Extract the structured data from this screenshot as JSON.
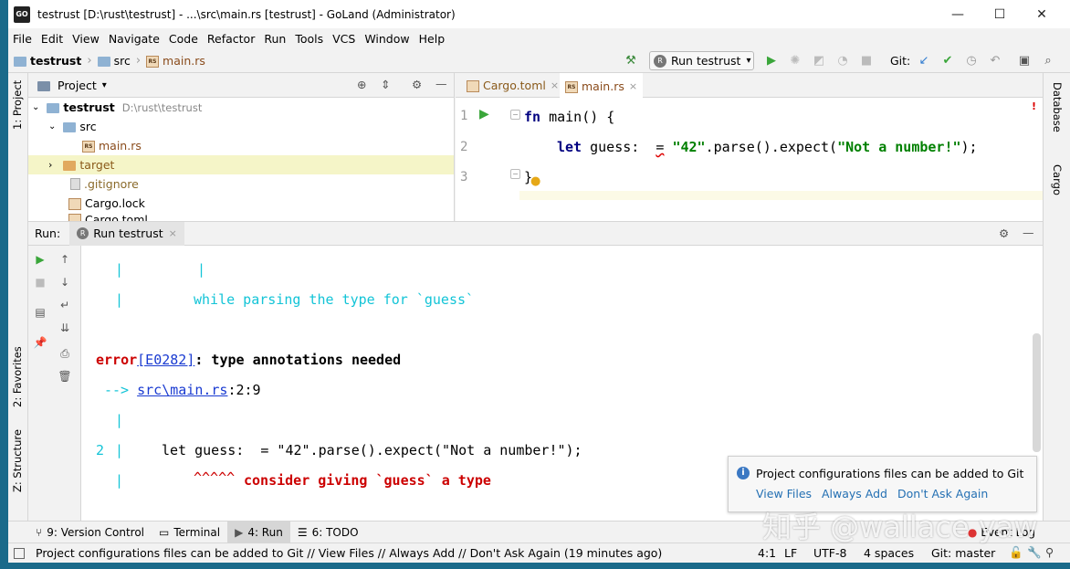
{
  "title": {
    "text": "testrust [D:\\rust\\testrust] - ...\\src\\main.rs [testrust] - GoLand (Administrator)",
    "app_icon": "GO"
  },
  "window_controls": {
    "minimize": "—",
    "maximize": "☐",
    "close": "✕"
  },
  "menu": [
    "File",
    "Edit",
    "View",
    "Navigate",
    "Code",
    "Refactor",
    "Run",
    "Tools",
    "VCS",
    "Window",
    "Help"
  ],
  "breadcrumb": {
    "project": "testrust",
    "folder": "src",
    "file": "main.rs"
  },
  "toolbar": {
    "run_config": "Run testrust",
    "git_label": "Git:"
  },
  "left_tool_windows": {
    "project": "1: Project",
    "favorites": "2: Favorites",
    "structure": "Z: Structure"
  },
  "right_tool_windows": {
    "database": "Database",
    "cargo": "Cargo"
  },
  "project_panel": {
    "header": "Project",
    "tree": [
      {
        "label": "testrust",
        "path": "D:\\rust\\testrust",
        "icon": "folder-icon"
      },
      {
        "label": "src",
        "icon": "folder-icon"
      },
      {
        "label": "main.rs",
        "icon": "rust-file-icon"
      },
      {
        "label": "target",
        "icon": "folder-icon"
      },
      {
        "label": ".gitignore",
        "icon": "file-icon"
      },
      {
        "label": "Cargo.lock",
        "icon": "file-icon"
      },
      {
        "label": "Cargo.toml",
        "icon": "file-icon"
      }
    ]
  },
  "editor": {
    "tabs": [
      {
        "label": "Cargo.toml"
      },
      {
        "label": "main.rs"
      }
    ],
    "line_numbers": [
      "1",
      "2",
      "3"
    ],
    "lines": [
      {
        "kw": "fn",
        "rest": " main() {"
      },
      {
        "kw": "let",
        "mid": " guess:  ",
        "squig": "=",
        "str1": "\"42\"",
        "mid2": ".parse().expect(",
        "str2": "\"Not a number!\"",
        "end": ");"
      },
      {
        "rest": "}"
      }
    ]
  },
  "run_panel": {
    "label": "Run:",
    "tab": "Run testrust",
    "console": {
      "l0_cut": "  |                  ",
      "l1_pipe1": "|",
      "l1_pipe2": "|",
      "l2_pipe": "|",
      "l2_msg": "while parsing the type for `guess`",
      "err_word": "error",
      "err_code": "[E0282]",
      "err_msg": ": type annotations needed",
      "arrow": "-->",
      "loc_link": "src\\main.rs",
      "loc_rest": ":2:9",
      "l6_pipe": "|",
      "l7_num": "2",
      "l7_pipe": "|",
      "l7_code": "let guess:  = \"42\".parse().expect(\"Not a number!\");",
      "l8_pipe": "|",
      "l8_carets": "^^^^^",
      "l8_msg": "consider giving `guess` a type"
    }
  },
  "notification": {
    "text": "Project configurations files can be added to Git",
    "view_files": "View Files",
    "always_add": "Always Add",
    "dont_ask": "Don't Ask Again"
  },
  "bottom_tabs": [
    {
      "label": "9: Version Control"
    },
    {
      "label": "Terminal"
    },
    {
      "label": "4: Run"
    },
    {
      "label": "6: TODO"
    }
  ],
  "event_log": "Event Log",
  "status": {
    "message": "Project configurations files can be added to Git // View Files // Always Add // Don't Ask Again (19 minutes ago)",
    "position": "4:1",
    "line_sep": "LF",
    "encoding": "UTF-8",
    "indent": "4 spaces",
    "vcs": "Git: master"
  },
  "watermark": "知乎 @wallace yaw",
  "colors": {
    "keyword": "#000080",
    "string": "#008000",
    "console_cyan": "#13c4d7",
    "error_red": "#cc0000",
    "link": "#2470b3",
    "accent": "#1a6a8a"
  }
}
